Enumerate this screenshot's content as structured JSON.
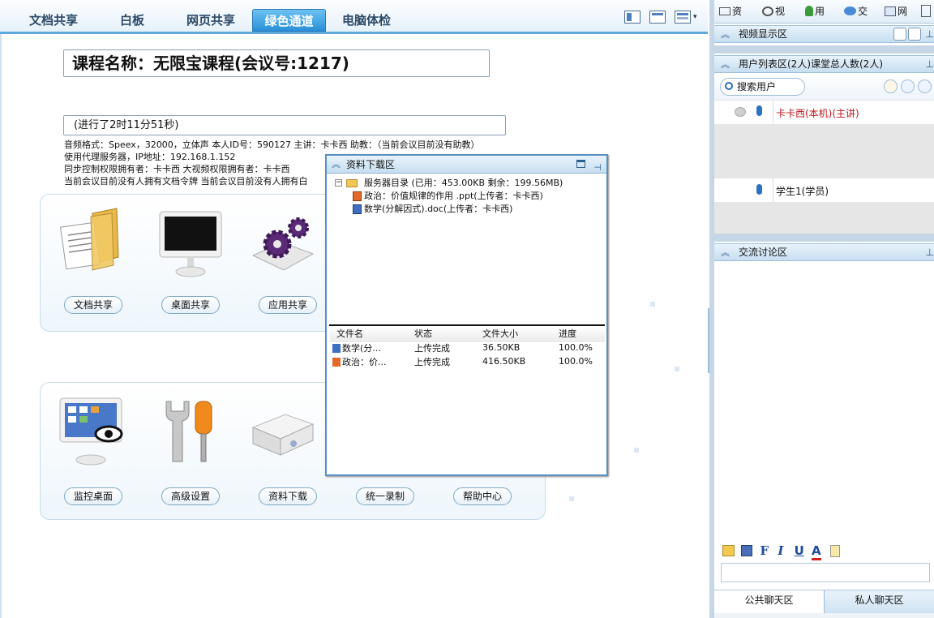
{
  "tabs": [
    "文档共享",
    "白板",
    "网页共享",
    "绿色通道",
    "电脑体检"
  ],
  "active_tab": "绿色通道",
  "course": {
    "title": "课程名称：无限宝课程(会议号:1217)",
    "elapsed": "(进行了2时11分51秒)"
  },
  "meeting_info": [
    "音频格式：Speex，32000，立体声 本人ID号：590127 主讲：卡卡西 助教：（当前会议目前没有助教）",
    "使用代理服务器，IP地址：192.168.1.152",
    "同步控制权限拥有者：卡卡西 大视频权限拥有者：卡卡西",
    "当前会议目前没有人拥有文档令牌 当前会议目前没有人拥有白"
  ],
  "panel1_buttons": [
    "文档共享",
    "桌面共享",
    "应用共享"
  ],
  "panel2_buttons": [
    "监控桌面",
    "高级设置",
    "资料下载",
    "统一录制",
    "帮助中心"
  ],
  "download_window": {
    "title": "资料下载区",
    "server_dir": "服务器目录 (已用：453.00KB 剩余：199.56MB)",
    "files": [
      "政治：价值规律的作用 .ppt(上传者：卡卡西)",
      "数学(分解因式).doc(上传者：卡卡西)"
    ],
    "table_headers": [
      "文件名",
      "状态",
      "文件大小",
      "进度"
    ],
    "rows": [
      {
        "name": "数学(分...",
        "status": "上传完成",
        "size": "36.50KB",
        "progress": "100.0%"
      },
      {
        "name": "政治：价...",
        "status": "上传完成",
        "size": "416.50KB",
        "progress": "100.0%"
      }
    ]
  },
  "right": {
    "toolbar": [
      "资",
      "视",
      "用",
      "交",
      "网"
    ],
    "video_title": "视频显示区",
    "userlist_title": "用户列表区(2人)课堂总人数(2人)",
    "search_placeholder": "搜索用户",
    "users": [
      {
        "name": "卡卡西(本机)(主讲)",
        "color": "#c0141c"
      },
      {
        "name": "学生1(学员)",
        "color": "#111111"
      }
    ],
    "chat_title": "交流讨论区",
    "chat_tabs": [
      "公共聊天区",
      "私人聊天区"
    ]
  }
}
